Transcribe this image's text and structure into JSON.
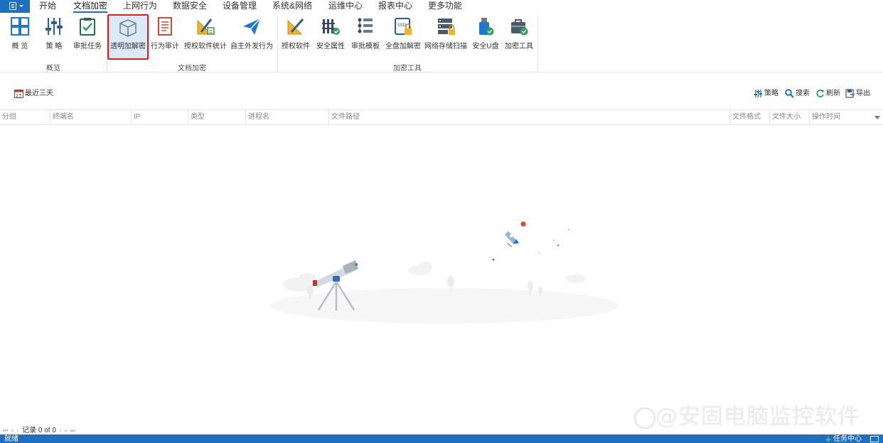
{
  "menu": {
    "tabs": [
      "开始",
      "文档加密",
      "上网行为",
      "数据安全",
      "设备管理",
      "系统&网络",
      "运维中心",
      "报表中心",
      "更多功能"
    ],
    "active_tab": "文档加密"
  },
  "ribbon": {
    "groups": [
      {
        "label": "概览",
        "buttons": [
          {
            "label": "概 览",
            "icon": "overview-grid-icon"
          },
          {
            "label": "策 略",
            "icon": "policy-sliders-icon"
          },
          {
            "label": "审批任务",
            "icon": "approval-task-icon"
          }
        ]
      },
      {
        "label": "文档加密",
        "buttons": [
          {
            "label": "透明加解密",
            "icon": "transparent-encrypt-cube-icon",
            "selected": true
          },
          {
            "label": "行为审计",
            "icon": "behavior-audit-icon"
          },
          {
            "label": "授权软件统计",
            "icon": "authorized-software-stats-icon"
          },
          {
            "label": "自主外发行为",
            "icon": "outbound-send-icon"
          }
        ]
      },
      {
        "label": "加密工具",
        "buttons": [
          {
            "label": "授权软件",
            "icon": "authorized-software-icon"
          },
          {
            "label": "安全属性",
            "icon": "security-attribute-icon"
          },
          {
            "label": "审批模板",
            "icon": "approval-template-icon"
          },
          {
            "label": "全盘加解密",
            "icon": "full-disk-encrypt-icon"
          },
          {
            "label": "网络存储扫描",
            "icon": "network-storage-scan-icon"
          },
          {
            "label": "安全U盘",
            "icon": "secure-usb-icon"
          },
          {
            "label": "加密工具",
            "icon": "encrypt-tool-icon"
          }
        ]
      }
    ]
  },
  "toolbar": {
    "date_filter": "最近三天",
    "date_icon_text": "23",
    "policy": "策略",
    "search": "搜索",
    "refresh": "刷新",
    "export": "导出"
  },
  "grid": {
    "columns": [
      "分组",
      "终端名",
      "IP",
      "类型",
      "进程名",
      "文件路径",
      "文件格式",
      "文件大小",
      "操作时间"
    ]
  },
  "pager": {
    "record_text": "记录 0 of 0"
  },
  "watermark": {
    "text": "@安固电脑监控软件"
  },
  "status": {
    "left": "就绪",
    "right": "任务中心"
  },
  "colors": {
    "accent": "#1e6fc0",
    "selected_bg": "#dceaf8",
    "highlight_border": "#e01c1c"
  }
}
